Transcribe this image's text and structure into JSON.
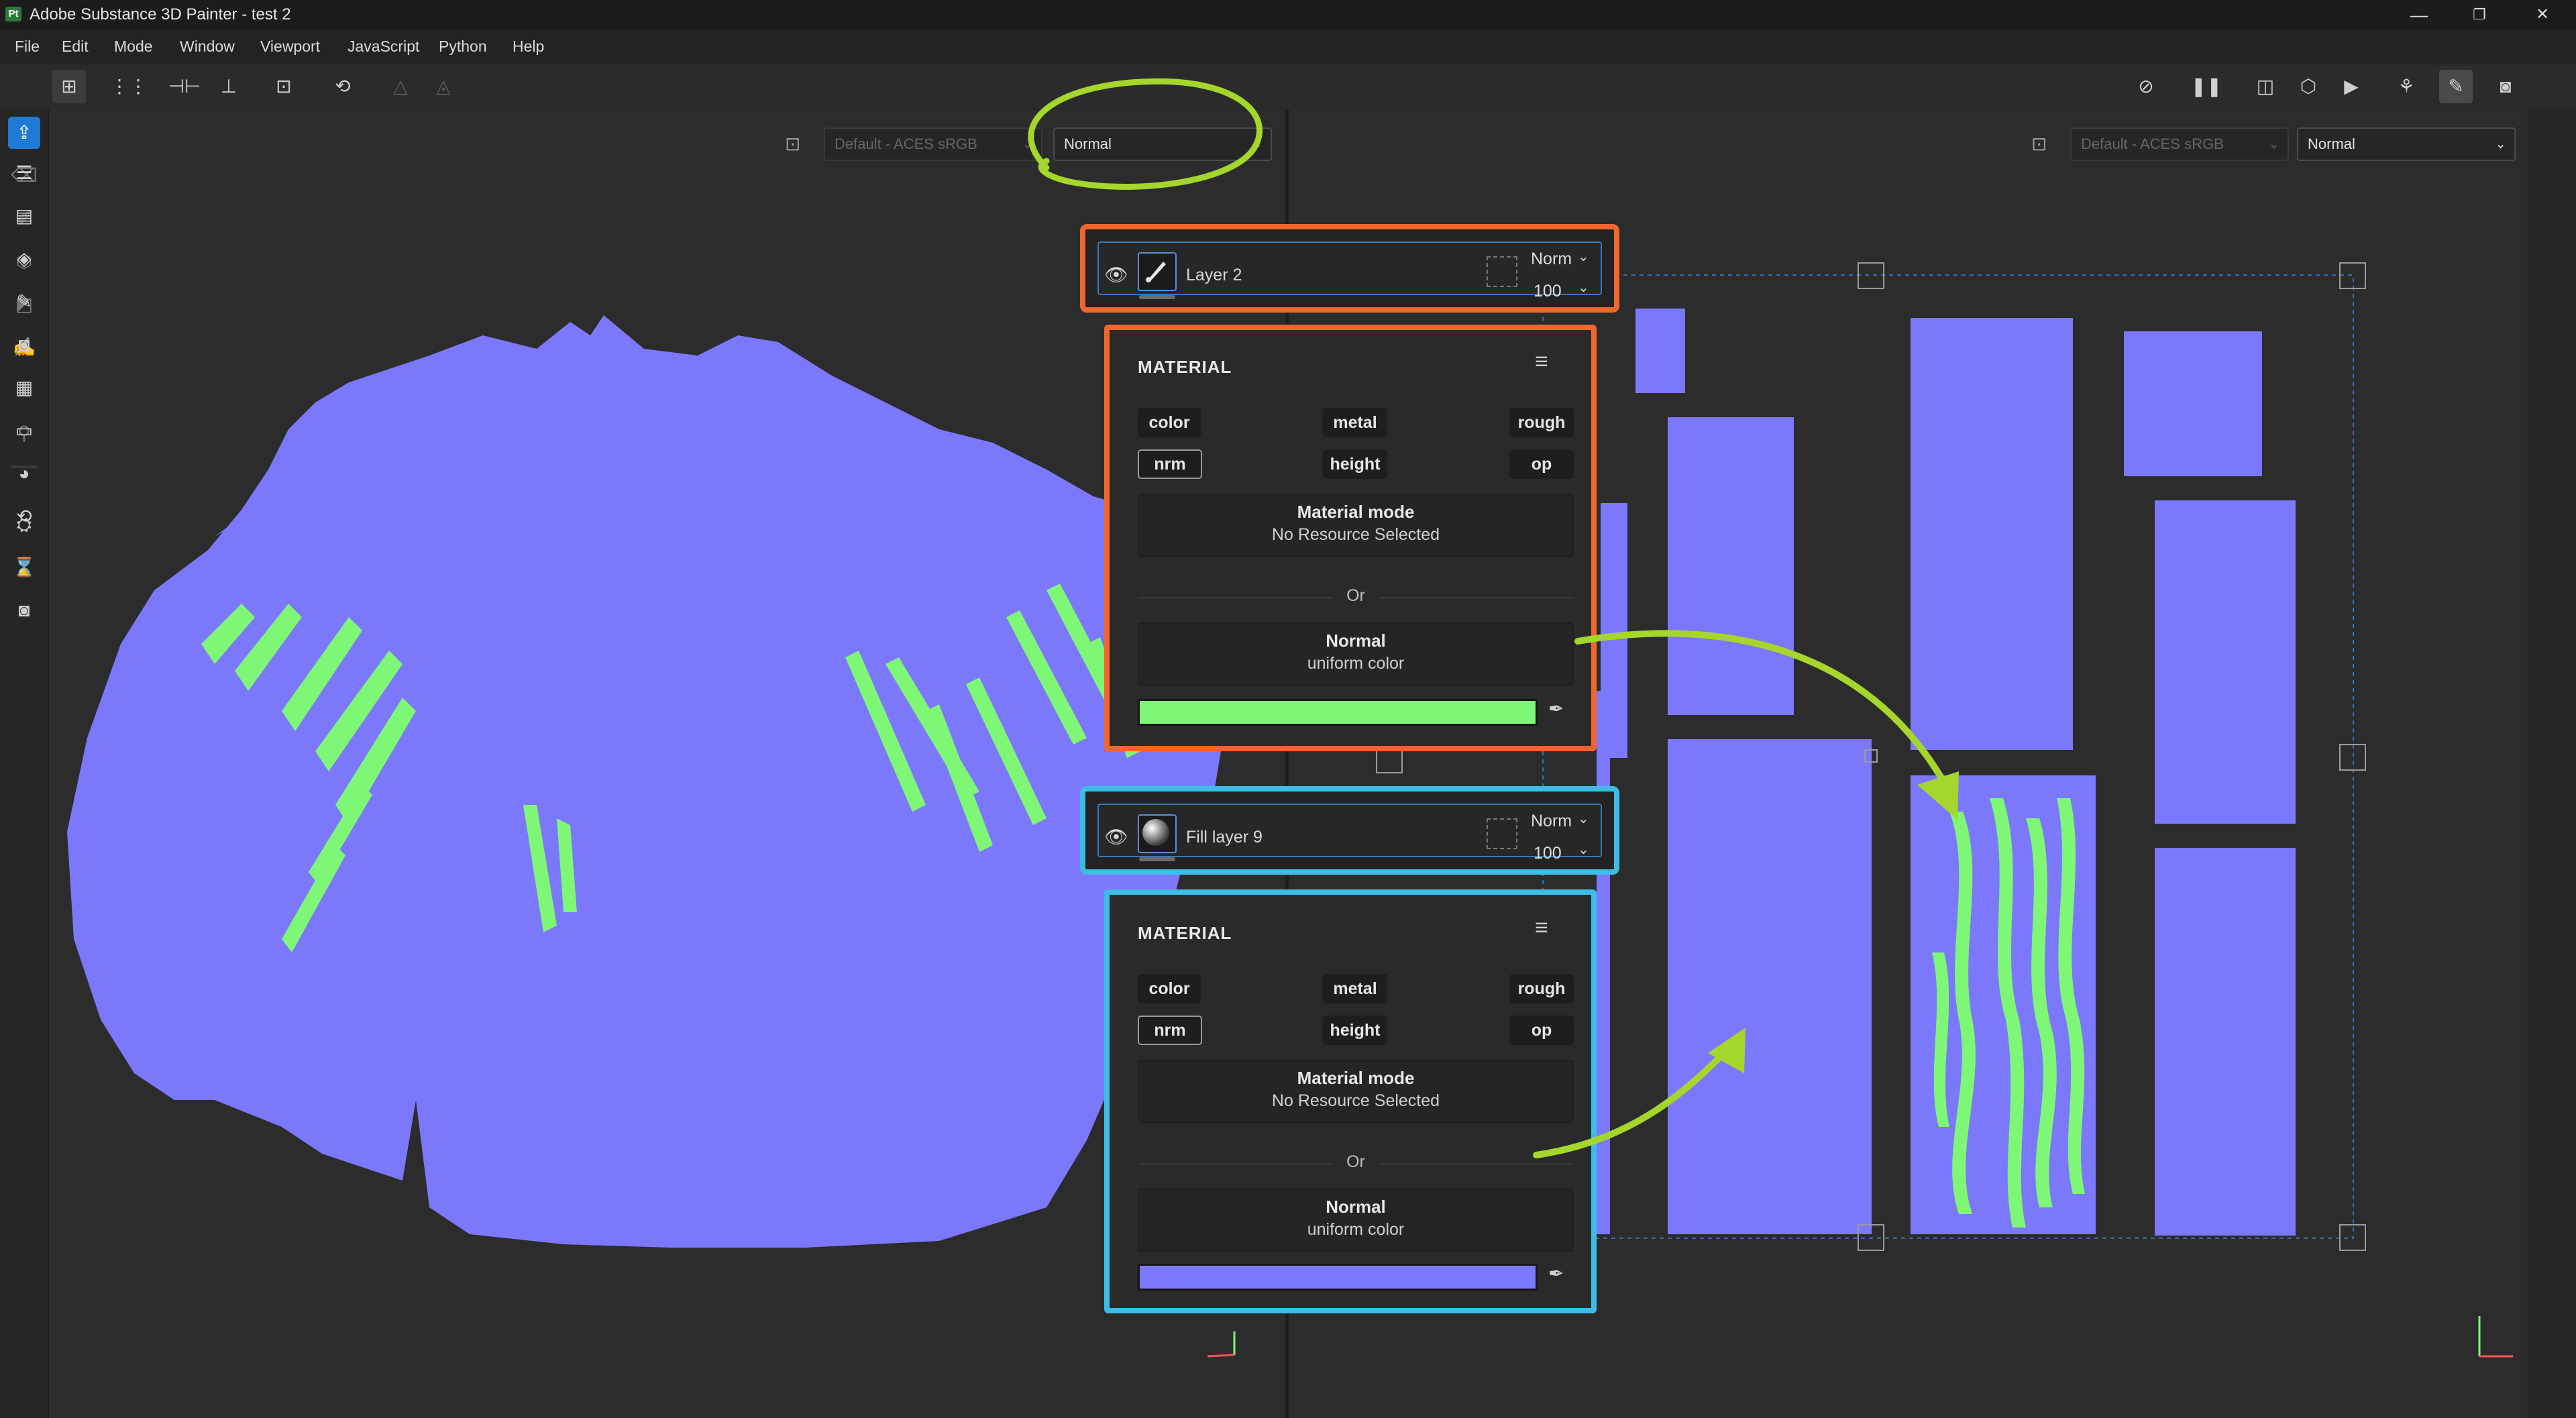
{
  "app": {
    "icon_text": "Pt",
    "title": "Adobe Substance 3D Painter - test 2",
    "window_controls": {
      "minimize": "—",
      "maximize": "❐",
      "close": "✕"
    }
  },
  "menu": [
    "File",
    "Edit",
    "Mode",
    "Window",
    "Viewport",
    "JavaScript",
    "Python",
    "Help"
  ],
  "viewport3d": {
    "colorspace": "Default - ACES sRGB",
    "display_mode": "Normal"
  },
  "viewport2d": {
    "colorspace": "Default - ACES sRGB",
    "display_mode": "Normal"
  },
  "layers": [
    {
      "name": "Layer 2",
      "blend": "Norm",
      "opacity": "100",
      "thumbnail_icon": "brush-icon",
      "frame_color": "#f0672e",
      "material": {
        "title": "MATERIAL",
        "channels": [
          "color",
          "metal",
          "rough",
          "nrm",
          "height",
          "op"
        ],
        "mode_title": "Material mode",
        "mode_value": "No Resource Selected",
        "or_label": "Or",
        "uniform_title": "Normal",
        "uniform_value": "uniform color",
        "swatch_color": "#7ef776"
      }
    },
    {
      "name": "Fill layer 9",
      "blend": "Norm",
      "opacity": "100",
      "thumbnail_icon": "sphere-icon",
      "frame_color": "#3dbde6",
      "material": {
        "title": "MATERIAL",
        "channels": [
          "color",
          "metal",
          "rough",
          "nrm",
          "height",
          "op"
        ],
        "mode_title": "Material mode",
        "mode_value": "No Resource Selected",
        "or_label": "Or",
        "uniform_title": "Normal",
        "uniform_value": "uniform color",
        "swatch_color": "#7d79ff"
      }
    }
  ],
  "colors": {
    "normal_map_blue": "#7c78fb",
    "highlight_green": "#7ef776",
    "annotation_green": "#a4d62c",
    "selection_blue": "#3a78b8"
  }
}
